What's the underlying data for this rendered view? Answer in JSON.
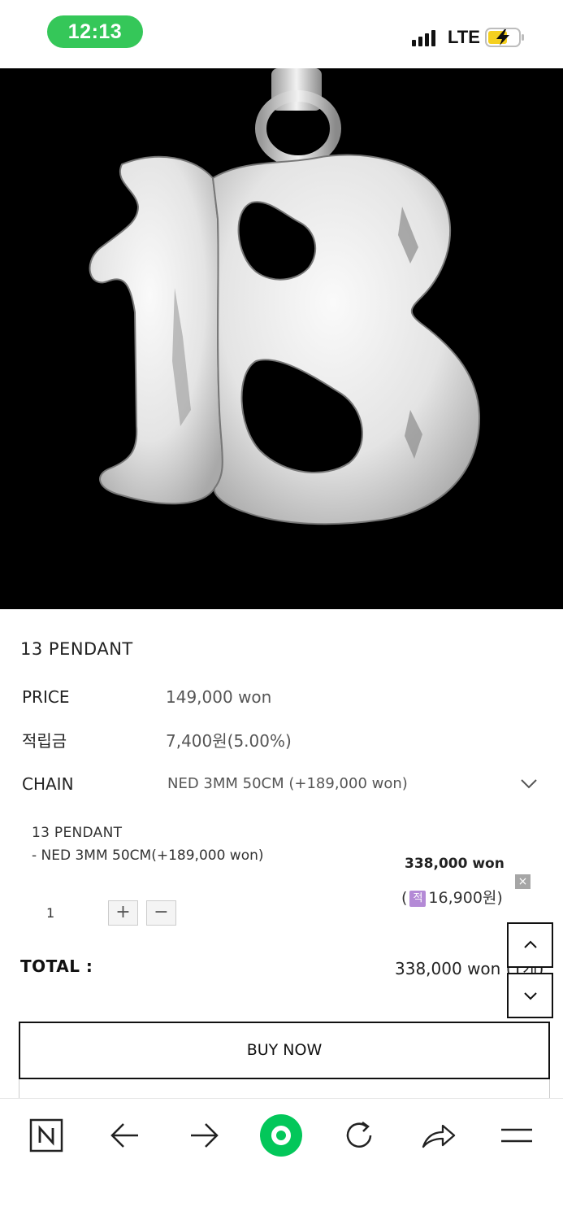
{
  "status_bar": {
    "time": "12:13",
    "network": "LTE",
    "colors": {
      "time_pill": "#35c759",
      "battery_fill": "#f5d020"
    }
  },
  "hero": {
    "alt": "13 pendant silver on black background",
    "background": "#000000"
  },
  "product": {
    "title": "13 PENDANT",
    "price_label": "PRICE",
    "price_value": "149,000 won",
    "points_label": "적립금",
    "points_value": "7,400원(5.00%)",
    "chain_label": "CHAIN",
    "chain_selected": "NED 3MM 50CM (+189,000 won)"
  },
  "selected_option": {
    "name": "13 PENDANT",
    "desc": "- NED 3MM 50CM(+189,000 won)",
    "price": "338,000 won",
    "points_open": "(",
    "points_badge": "적",
    "points_amount": "16,900원)",
    "remove_symbol": "×",
    "quantity": "1",
    "plus": "+",
    "minus": "−"
  },
  "total": {
    "label": "TOTAL :",
    "value": "338,000 won (1개)"
  },
  "buy_button": "BUY NOW",
  "toolbar": {
    "icons": [
      "naver-icon",
      "back-arrow-icon",
      "forward-arrow-icon",
      "home-circle-icon",
      "refresh-icon",
      "share-icon",
      "menu-icon"
    ],
    "accent": "#03c75a"
  }
}
